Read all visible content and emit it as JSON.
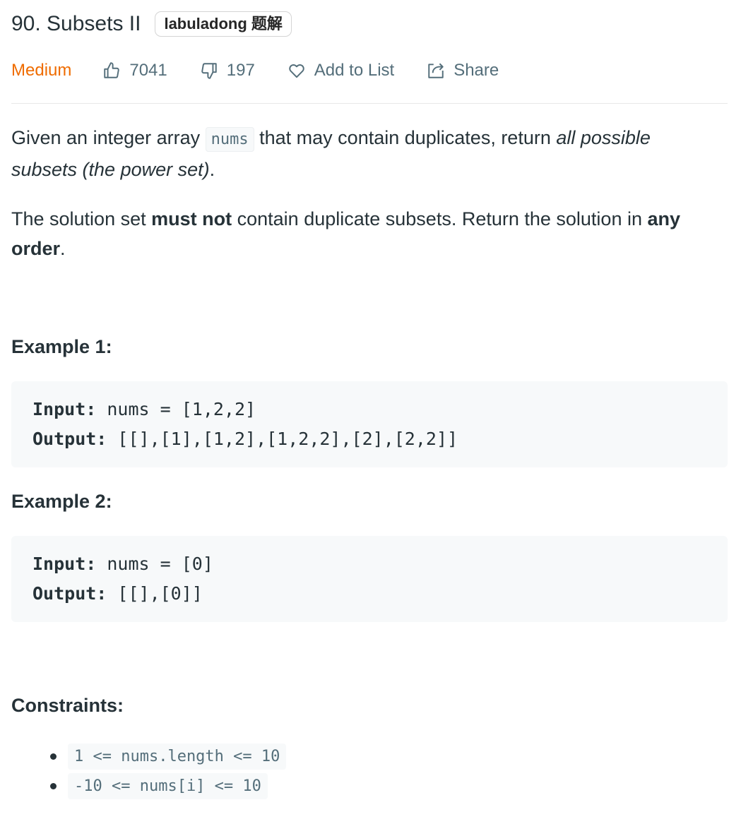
{
  "problem": {
    "title": "90. Subsets II",
    "tag": "labuladong 题解",
    "difficulty": "Medium",
    "likes": "7041",
    "dislikes": "197",
    "add_to_list": "Add to List",
    "share": "Share"
  },
  "description": {
    "p1_a": "Given an integer array ",
    "p1_code": "nums",
    "p1_b": " that may contain duplicates, return ",
    "p1_em": "all possible subsets (the power set)",
    "p1_c": ".",
    "p2_a": "The solution set ",
    "p2_strong1": "must not",
    "p2_b": " contain duplicate subsets. Return the solution in ",
    "p2_strong2": "any order",
    "p2_c": "."
  },
  "examples": [
    {
      "heading": "Example 1:",
      "input_label": "Input:",
      "input_value": " nums = [1,2,2]",
      "output_label": "Output:",
      "output_value": " [[],[1],[1,2],[1,2,2],[2],[2,2]]"
    },
    {
      "heading": "Example 2:",
      "input_label": "Input:",
      "input_value": " nums = [0]",
      "output_label": "Output:",
      "output_value": " [[],[0]]"
    }
  ],
  "constraints": {
    "heading": "Constraints:",
    "items": [
      "1 <= nums.length <= 10",
      "-10 <= nums[i] <= 10"
    ]
  },
  "colors": {
    "difficulty_medium": "#ef6c00",
    "meta_text": "#546e7a",
    "code_bg": "#f7f9fa"
  },
  "icons": [
    "thumbs-up-icon",
    "thumbs-down-icon",
    "heart-icon",
    "share-icon"
  ]
}
